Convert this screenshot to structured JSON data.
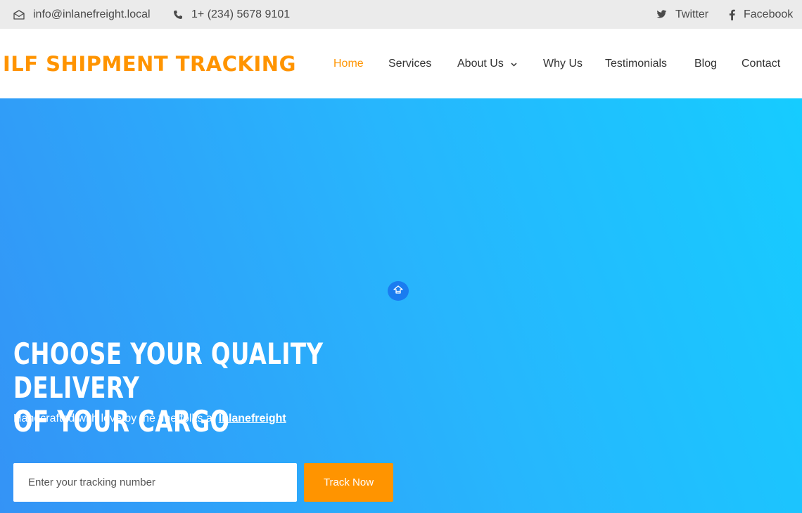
{
  "topbar": {
    "email": "info@inlanefreight.local",
    "phone": "1+ (234) 5678 9101",
    "twitter": "Twitter",
    "facebook": "Facebook",
    "icons": {
      "email": "envelope-icon",
      "phone": "phone-icon",
      "twitter": "twitter-icon",
      "facebook": "facebook-icon"
    }
  },
  "header": {
    "logo": "ILF SHIPMENT TRACKING",
    "nav": [
      {
        "label": "Home",
        "active": true
      },
      {
        "label": "Services"
      },
      {
        "label": "About Us",
        "dropdown": true
      },
      {
        "label": "Why Us"
      },
      {
        "label": "Testimonials"
      },
      {
        "label": "Blog"
      },
      {
        "label": "Contact"
      }
    ]
  },
  "hero": {
    "title_line1": "CHOOSE YOUR QUALITY DELIVERY",
    "title_line2": "OF YOUR CARGO",
    "subtitle_prefix": "Handcrafted with love by the fine folks at",
    "subtitle_link": "Inlanefreight",
    "tracking_placeholder": "Enter your tracking number",
    "tracking_value": "",
    "track_button": "Track Now"
  },
  "colors": {
    "accent": "#ff9400",
    "gradient_start": "#3493f6",
    "gradient_end": "#16ccff",
    "topbar_bg": "#ebebeb"
  }
}
